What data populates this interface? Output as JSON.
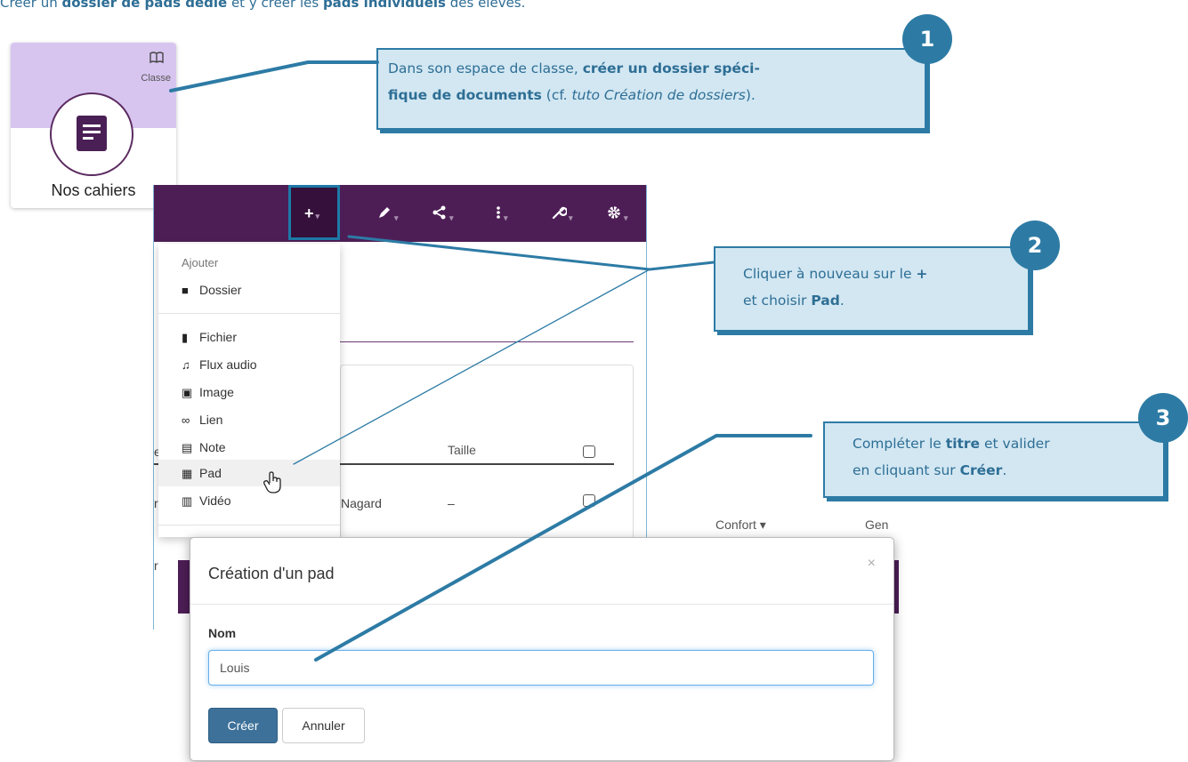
{
  "heading": {
    "part1": "Créer un ",
    "bold1": "dossier de pads dédié",
    "part2": " et y créer les ",
    "bold2": "pads individuels",
    "part3": " des élèves."
  },
  "tile": {
    "icon_top": "book-icon",
    "context": "Classe",
    "icon_main": "notebook-icon",
    "name": "Nos cahiers",
    "colors": {
      "top_bg": "#d7c5f0",
      "icon": "#4a1f55"
    }
  },
  "toolbar": {
    "buttons": [
      {
        "icon": "plus-icon",
        "symbol": "+"
      },
      {
        "icon": "pencil-icon",
        "symbol": "✎"
      },
      {
        "icon": "share-icon",
        "symbol": "<"
      },
      {
        "icon": "more-vertical-icon",
        "symbol": "⋮"
      },
      {
        "icon": "wrench-icon",
        "symbol": "🔧"
      },
      {
        "icon": "gear-icon",
        "symbol": "⚙"
      }
    ],
    "color": "#4d1e56"
  },
  "menu": {
    "header": "Ajouter",
    "items": [
      {
        "icon": "folder-icon",
        "glyph": "■",
        "label": "Dossier"
      },
      {
        "icon": "file-icon",
        "glyph": "▮",
        "label": "Fichier"
      },
      {
        "icon": "music-icon",
        "glyph": "♫",
        "label": "Flux audio"
      },
      {
        "icon": "image-icon",
        "glyph": "▣",
        "label": "Image"
      },
      {
        "icon": "link-icon",
        "glyph": "∞",
        "label": "Lien"
      },
      {
        "icon": "note-icon",
        "glyph": "▤",
        "label": "Note"
      },
      {
        "icon": "pad-icon",
        "glyph": "▦",
        "label": "Pad"
      },
      {
        "icon": "video-icon",
        "glyph": "▥",
        "label": "Vidéo"
      }
    ]
  },
  "table": {
    "col_size": "Taille",
    "row_owner": "Nagard",
    "row_size": "–"
  },
  "callouts": [
    {
      "number": "1",
      "parts": [
        {
          "t": "Dans son espace de classe, ",
          "s": "n"
        },
        {
          "t": "créer un dossier spéci-",
          "s": "b"
        },
        {
          "t": "fique de documents",
          "s": "b",
          "br": true
        },
        {
          "t": " (cf. ",
          "s": "n"
        },
        {
          "t": "tuto Création de dossiers",
          "s": "i"
        },
        {
          "t": ").",
          "s": "n"
        }
      ]
    },
    {
      "number": "2",
      "parts": [
        {
          "t": "Cliquer à nouveau sur le ",
          "s": "n"
        },
        {
          "t": "+",
          "s": "b"
        },
        {
          "t": "et choisir ",
          "s": "n",
          "br": true
        },
        {
          "t": "Pad",
          "s": "b"
        },
        {
          "t": ".",
          "s": "n"
        }
      ]
    },
    {
      "number": "3",
      "parts": [
        {
          "t": "Compléter le ",
          "s": "n"
        },
        {
          "t": "titre",
          "s": "b"
        },
        {
          "t": " et valider",
          "s": "n"
        },
        {
          "t": "en cliquant sur ",
          "s": "n",
          "br": true
        },
        {
          "t": "Créer",
          "s": "b"
        },
        {
          "t": ".",
          "s": "n"
        }
      ]
    }
  ],
  "background": {
    "comfort": "Confort ▾",
    "other": "Gen"
  },
  "dialog": {
    "title": "Création d'un pad",
    "close": "×",
    "field_label": "Nom",
    "field_value": "Louis",
    "create": "Créer",
    "cancel": "Annuler"
  },
  "colors": {
    "accent": "#2d7ba5",
    "callout_bg": "#d2e7f2",
    "purple": "#4d1e56"
  }
}
